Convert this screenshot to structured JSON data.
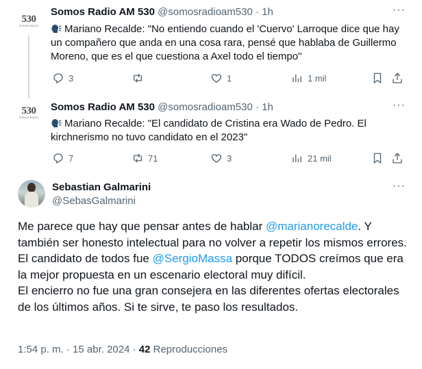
{
  "tweets": [
    {
      "name": "Somos Radio AM 530",
      "handle": "@somosradioam530",
      "separator": "·",
      "time": "1h",
      "avatar_text": "530",
      "avatar_sub": "SOMOS RADIO",
      "text": "Mariano Recalde: \"No entiendo cuando el 'Cuervo' Larroque dice que hay un compañero que anda en una cosa rara, pensé que hablaba de Guillermo Moreno, que es el que cuestiona a Axel todo el tiempo\"",
      "replies": "3",
      "retweets": "",
      "likes": "1",
      "views": "1 mil"
    },
    {
      "name": "Somos Radio AM 530",
      "handle": "@somosradioam530",
      "separator": "·",
      "time": "1h",
      "avatar_text": "530",
      "avatar_sub": "SOMOS RADIO",
      "text": "Mariano Recalde: \"El candidato de Cristina era Wado de Pedro. El kirchnerismo no tuvo candidato en el 2023\"",
      "replies": "7",
      "retweets": "71",
      "likes": "3",
      "views": "21 mil"
    }
  ],
  "main_tweet": {
    "name": "Sebastian Galmarini",
    "handle": "@SebasGalmarini",
    "line1_a": "Me parece que hay que pensar  antes de hablar ",
    "mention1": "@marianorecalde",
    "line1_b": ". Y también ser honesto intelectual para no volver a repetir los mismos errores.",
    "line2_a": "El candidato de todos fue ",
    "mention2": "@SergioMassa",
    "line2_b": " porque TODOS creímos que era la mejor propuesta en un escenario electoral muy difícil.",
    "line3": "El encierro no fue una gran consejera en las diferentes ofertas electorales de los últimos años. Si te sirve, te paso los resultados.",
    "timestamp": "1:54 p. m. · 15 abr. 2024 · ",
    "views_count": "42",
    "views_label": " Reproducciones"
  },
  "icons": [
    "speaking-head-emoji",
    "reply-icon",
    "retweet-icon",
    "like-icon",
    "views-icon",
    "bookmark-icon",
    "share-icon",
    "more-icon"
  ],
  "colors": {
    "text": "#0f1419",
    "secondary": "#536471",
    "link": "#1d9bf0",
    "line": "#cfd9de"
  }
}
